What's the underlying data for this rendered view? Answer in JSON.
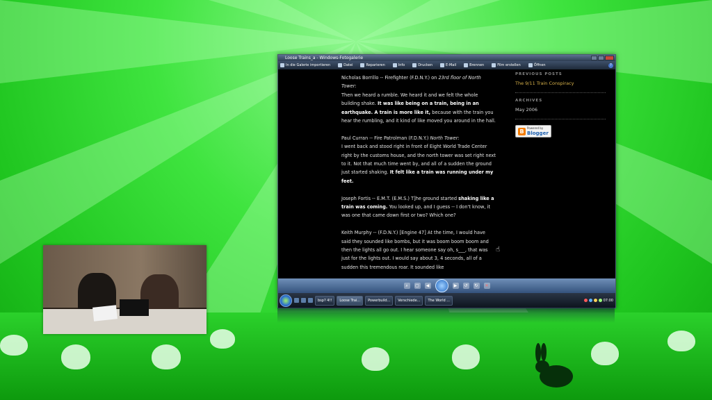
{
  "window": {
    "title": "Loose Trains_a - Windows-Fotogalerie",
    "menu": [
      {
        "label": "In die Galerie importieren",
        "icon": "import-icon"
      },
      {
        "label": "Datei",
        "icon": "file-icon"
      },
      {
        "label": "Reparieren",
        "icon": "repair-icon"
      },
      {
        "label": "Info",
        "icon": "info-icon"
      },
      {
        "label": "Drucken",
        "icon": "print-icon"
      },
      {
        "label": "E-Mail",
        "icon": "mail-icon"
      },
      {
        "label": "Brennen",
        "icon": "burn-icon"
      },
      {
        "label": "Film erstellen",
        "icon": "movie-icon"
      },
      {
        "label": "Öffnen",
        "icon": "open-icon"
      }
    ],
    "help_label": "?"
  },
  "post": {
    "p1_speaker": "Nicholas Borrillo -- Firefighter (F.D.N.Y.) on ",
    "p1_location": "23rd floor of North Tower:",
    "p1_a": "Then we heard a rumble. We heard it and we felt the whole building shake. ",
    "p1_b": "It was like being on a train, being in an earthquake. A train is more like it,",
    "p1_c": " because with the train you hear the rumbling, and it kind of like moved you around in the hall.",
    "p2_speaker": "Paul Curran -- Fire Patrolman (F.D.N.Y.) ",
    "p2_location": "North Tower:",
    "p2_a": "I went back and stood right in front of Eight World Trade Center right by the customs house, and the north tower was set right next to it. Not that much time went by, and all of a sudden the ground just started shaking. ",
    "p2_b": "It felt like a train was running under my feet.",
    "p3_a": "Joseph Fortis -- E.M.T. (E.M.S.) T]he ground started ",
    "p3_b": "shaking like a train was coming.",
    "p3_c": " You looked up, and I guess -- I don't know, it was one that came down first or two? Which one?",
    "p4_a": "Keith Murphy -- (F.D.N.Y.) [Engine 47] At the time, I would have said they sounded like bombs, but it was boom boom boom and then the lights all go out. I hear someone say oh, s___, that was just for the lights out. I would say about 3, 4 seconds, all of a sudden this tremendous roar. It sounded like"
  },
  "sidebar": {
    "prev_heading": "PREVIOUS POSTS",
    "prev_link": "The 9/11 Train Conspiracy",
    "archives_heading": "ARCHIVES",
    "archive_link": "May 2006",
    "badge_small": "Powered by",
    "badge_big": "Blogger"
  },
  "taskbar": {
    "items": [
      "bsp? 4!!",
      "Loose Trai...",
      "Powerbuild...",
      "Verschiede...",
      "The World ..."
    ],
    "clock": "07:00"
  },
  "colors": {
    "accent": "#d8b24a",
    "background": "#000000",
    "desktop": "#2bd12b"
  }
}
